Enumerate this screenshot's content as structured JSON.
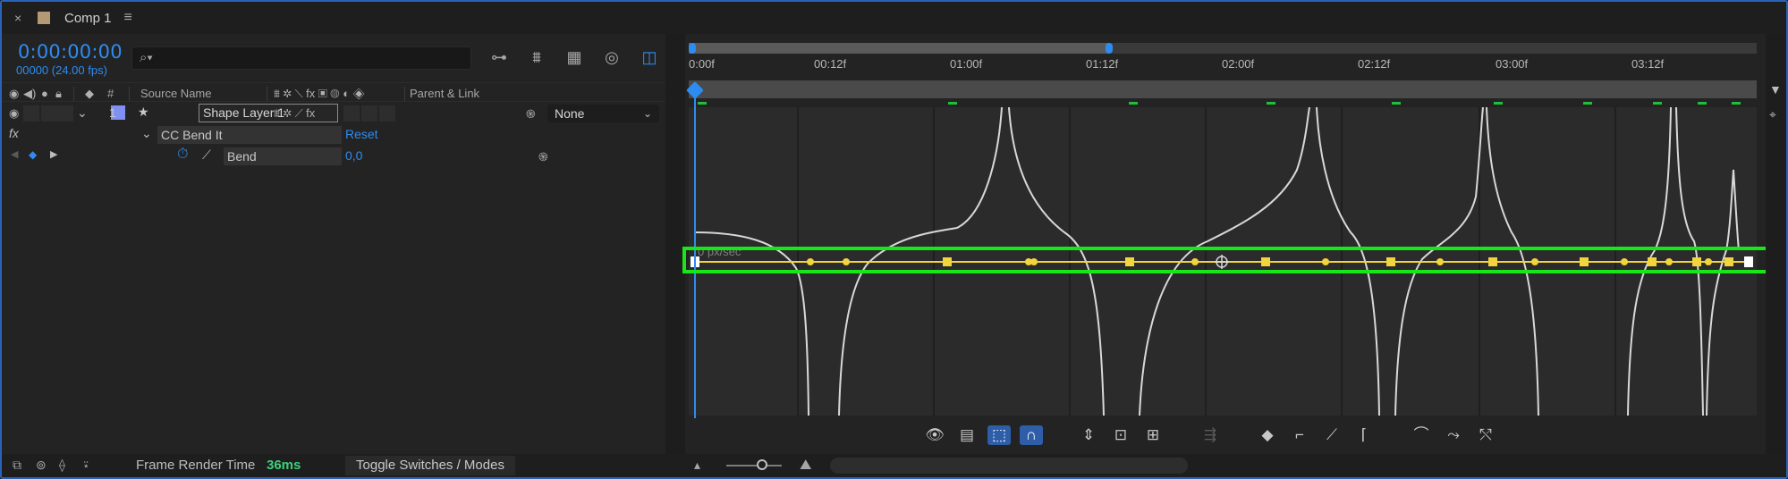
{
  "tab": {
    "close_glyph": "×",
    "title": "Comp 1",
    "menu_glyph": "≡",
    "swatch_color": "#b39a75"
  },
  "timecode": {
    "value": "0:00:00:00",
    "frames": "00000 (24.00 fps)",
    "color": "#2e8cf0"
  },
  "search": {
    "placeholder": "",
    "icon": "search-icon"
  },
  "columns": {
    "number": "#",
    "source_name": "Source Name",
    "parent_link": "Parent & Link",
    "fx": "fx"
  },
  "layer": {
    "index": "1",
    "name": "Shape Layer 1",
    "parent": "None",
    "label_color": "#7f8ff2"
  },
  "effect": {
    "fx_glyph": "fx",
    "name": "CC Bend It",
    "reset": "Reset"
  },
  "property": {
    "name": "Bend",
    "value": "0,0"
  },
  "ruler": {
    "labels": [
      "0:00f",
      "00:12f",
      "01:00f",
      "01:12f",
      "02:00f",
      "02:12f",
      "03:00f",
      "03:12f"
    ]
  },
  "graph": {
    "unit_label": "0 px/sec",
    "highlight_color": "#19e619"
  },
  "status": {
    "frame_render_label": "Frame Render Time",
    "frame_render_value": "36ms",
    "toggle_label": "Toggle Switches / Modes"
  }
}
